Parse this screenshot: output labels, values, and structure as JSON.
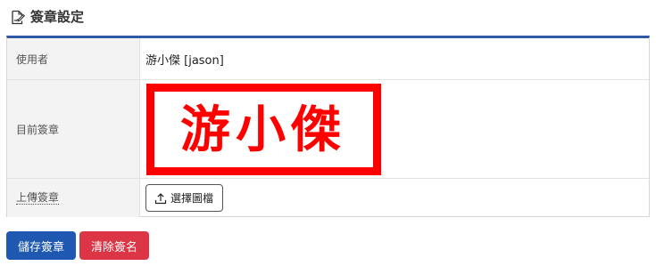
{
  "header": {
    "title": "簽章設定",
    "icon": "signature-edit-icon"
  },
  "form": {
    "user": {
      "label": "使用者",
      "value": "游小傑 [jason]"
    },
    "current_signature": {
      "label": "目前簽章",
      "stamp_text": "游小傑",
      "stamp_color": "#ff0000"
    },
    "upload": {
      "label": "上傳簽章",
      "button_label": "選擇圖檔",
      "button_icon": "upload-icon"
    }
  },
  "actions": {
    "save_label": "儲存簽章",
    "save_color": "#1f58b0",
    "clear_label": "清除簽名",
    "clear_color": "#dc3545"
  },
  "theme": {
    "accent": "#2f5aa7"
  }
}
